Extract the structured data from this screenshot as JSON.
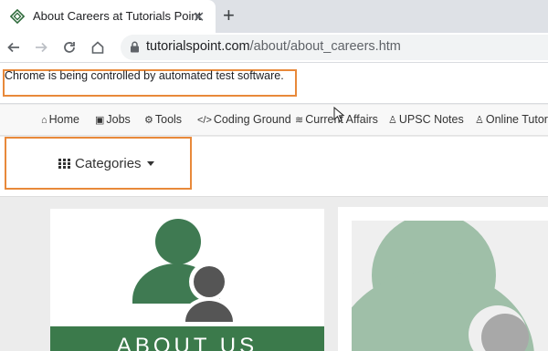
{
  "browser": {
    "tab_title": "About Careers at Tutorials Point",
    "tab_close": "✕",
    "new_tab": "+",
    "url_host": "tutorialspoint.com",
    "url_path": "/about/about_careers.htm",
    "infobar_text": "Chrome is being controlled by automated test software."
  },
  "site_nav": {
    "items": [
      {
        "label": "Home",
        "icon": "home-icon"
      },
      {
        "label": "Jobs",
        "icon": "briefcase-icon"
      },
      {
        "label": "Tools",
        "icon": "gears-icon"
      },
      {
        "label": "Coding Ground",
        "icon": "code-icon"
      },
      {
        "label": "Current Affairs",
        "icon": "layers-icon"
      },
      {
        "label": "UPSC Notes",
        "icon": "user-graduate-icon"
      },
      {
        "label": "Online Tutors",
        "icon": "user-icon"
      }
    ]
  },
  "categories": {
    "label": "Categories"
  },
  "content": {
    "banner_text": "ABOUT US"
  },
  "colors": {
    "highlight_border": "#e8893a",
    "banner_green": "#3b7a4b",
    "figure_green": "#3f7a52",
    "figure_gray": "#555555"
  }
}
